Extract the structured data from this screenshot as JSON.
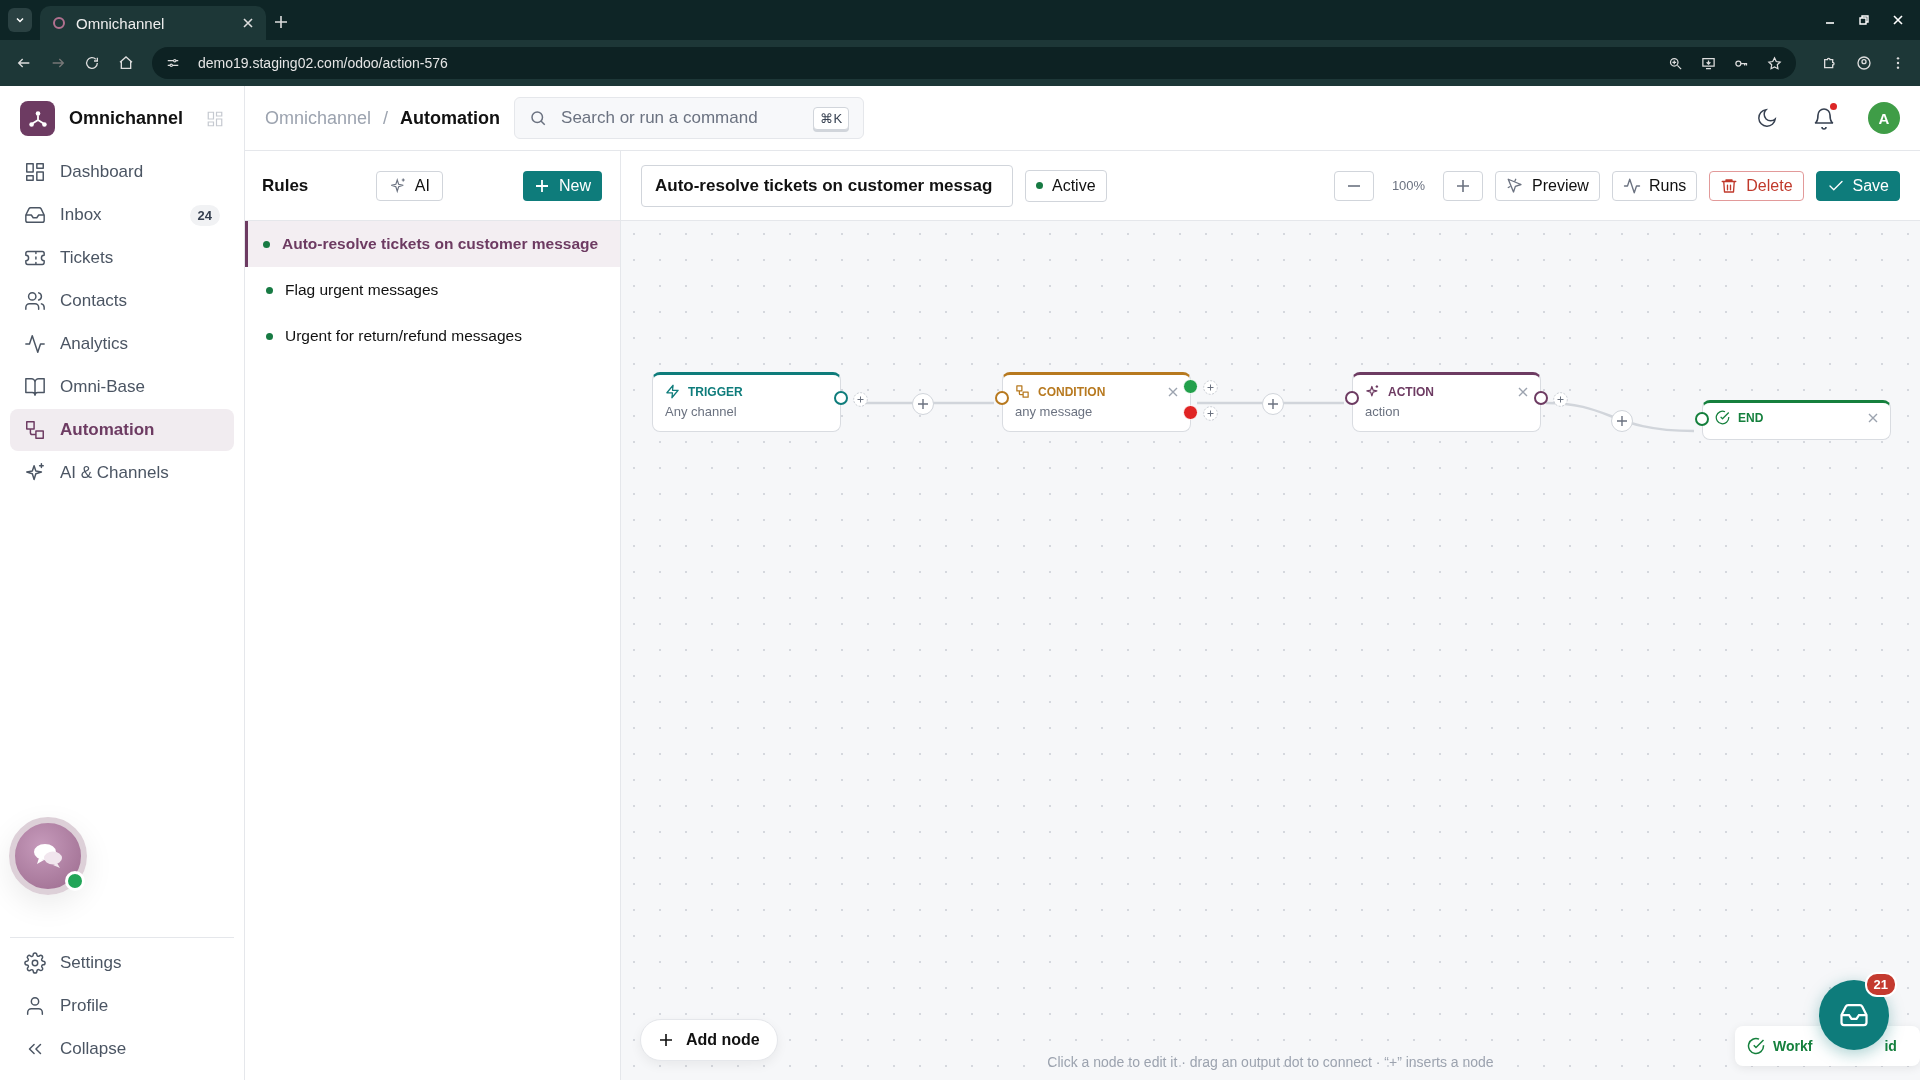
{
  "browser": {
    "tab_title": "Omnichannel",
    "url": "demo19.staging02.com/odoo/action-576"
  },
  "sidebar": {
    "brand": "Omnichannel",
    "items": [
      {
        "label": "Dashboard",
        "selected": false
      },
      {
        "label": "Inbox",
        "selected": false,
        "badge": "24"
      },
      {
        "label": "Tickets",
        "selected": false
      },
      {
        "label": "Contacts",
        "selected": false
      },
      {
        "label": "Analytics",
        "selected": false
      },
      {
        "label": "Omni-Base",
        "selected": false
      },
      {
        "label": "Automation",
        "selected": true
      },
      {
        "label": "AI & Channels",
        "selected": false
      }
    ],
    "chat_online": true,
    "footer_items": [
      "Settings",
      "Profile",
      "Collapse"
    ]
  },
  "topbar": {
    "breadcrumb": [
      "Omnichannel",
      "Automation"
    ],
    "breadcrumb_separator": "/",
    "search": {
      "placeholder": "Search or run a command",
      "shortcut": "⌘K"
    },
    "avatar": "A",
    "notification_unread": true
  },
  "rules": {
    "title": "Rules",
    "ai_button": "AI",
    "new_button": "New",
    "items": [
      {
        "name": "Auto-resolve tickets on customer message",
        "selected": true,
        "active": true
      },
      {
        "name": "Flag urgent messages",
        "selected": false,
        "active": true
      },
      {
        "name": "Urgent for return/refund messages",
        "selected": false,
        "active": true
      }
    ]
  },
  "editor": {
    "title": "Auto-resolve tickets on customer messag",
    "status": "Active",
    "zoom": "100%",
    "buttons": [
      "Preview",
      "Runs",
      "Delete",
      "Save"
    ],
    "nodes": [
      {
        "kind": "trigger",
        "label": "TRIGGER",
        "subtitle": "Any channel",
        "removable": false
      },
      {
        "kind": "condition",
        "label": "CONDITION",
        "subtitle": "any message",
        "removable": true
      },
      {
        "kind": "action",
        "label": "ACTION",
        "subtitle": "action",
        "removable": true
      },
      {
        "kind": "end",
        "label": "END",
        "removable": true
      }
    ],
    "add_node": "Add node",
    "hint": "Click a node to edit it · drag an output dot to connect · “+” inserts a node",
    "toast": [
      "Workf",
      "id"
    ],
    "fab_badge": "21"
  }
}
